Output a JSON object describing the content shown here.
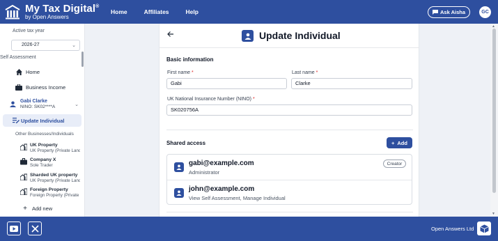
{
  "header": {
    "brand_title": "My Tax Digital",
    "brand_reg": "®",
    "brand_sub": "by Open Answers",
    "nav": [
      "Home",
      "Affiliates",
      "Help"
    ],
    "ask_label": "Ask Aisha",
    "avatar_initials": "GC",
    "color": "#2e4f9f"
  },
  "sidebar": {
    "year_label": "Active tax year",
    "year_value": "2026-27",
    "sa_label": "Self Assessment",
    "items": [
      {
        "label": "Home",
        "icon": "home-icon"
      },
      {
        "label": "Business Income",
        "icon": "briefcase-icon"
      }
    ],
    "person": {
      "name": "Gabi Clarke",
      "nino": "NINO: SK02****A"
    },
    "active_item": "Update Individual",
    "other_label": "Other Businesses/Individuals",
    "businesses": [
      {
        "title": "UK Property",
        "sub": "UK Property (Private Landlord)",
        "icon": "property-icon"
      },
      {
        "title": "Company X",
        "sub": "Sole Trader",
        "icon": "briefcase-icon"
      },
      {
        "title": "Sharded UK property",
        "sub": "UK Property (Private Landlord)",
        "icon": "property-icon"
      },
      {
        "title": "Foreign Property",
        "sub": "Foreign Property (Private Landlord)",
        "icon": "property-icon"
      }
    ],
    "add_new": "Add new"
  },
  "main": {
    "title": "Update Individual",
    "basic_info": "Basic information",
    "first_name_label": "First name",
    "first_name": "Gabi",
    "last_name_label": "Last name",
    "last_name": "Clarke",
    "nino_label": "UK National Insurance Number (NINO)",
    "nino": "SK020756A",
    "required_mark": "*",
    "shared_access": "Shared access",
    "add_label": "Add",
    "users": [
      {
        "email": "gabi@example.com",
        "role": "Administrator",
        "badge": "Creator"
      },
      {
        "email": "john@example.com",
        "role": "View Self Assessment, Manage Individual",
        "badge": ""
      }
    ]
  },
  "footer": {
    "company": "Open Answers Ltd"
  }
}
